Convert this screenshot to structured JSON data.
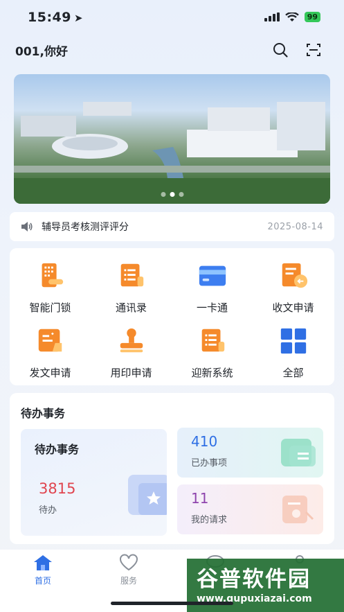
{
  "status_bar": {
    "time": "15:49",
    "battery": "99"
  },
  "header": {
    "greeting": "001,你好"
  },
  "banner": {
    "slide_count": 3,
    "active_slide": 2
  },
  "notice": {
    "title": "辅导员考核测评评分",
    "date": "2025-08-14"
  },
  "quick_apps": [
    {
      "label": "智能门锁",
      "icon": "smart-lock-icon"
    },
    {
      "label": "通讯录",
      "icon": "contacts-icon"
    },
    {
      "label": "一卡通",
      "icon": "card-icon"
    },
    {
      "label": "收文申请",
      "icon": "receive-doc-icon"
    },
    {
      "label": "发文申请",
      "icon": "send-doc-icon"
    },
    {
      "label": "用印申请",
      "icon": "seal-icon"
    },
    {
      "label": "迎新系统",
      "icon": "welcome-system-icon"
    },
    {
      "label": "全部",
      "icon": "all-apps-icon"
    }
  ],
  "todo": {
    "section_title": "待办事务",
    "pending": {
      "title": "待办事务",
      "count": "3815",
      "label": "待办"
    },
    "done": {
      "count": "410",
      "label": "已办事项"
    },
    "requests": {
      "count": "11",
      "label": "我的请求"
    }
  },
  "tabbar": {
    "items": [
      {
        "label": "首页"
      },
      {
        "label": "服务"
      }
    ]
  },
  "watermark": {
    "title": "谷普软件园",
    "url": "www.gupuxiazai.com"
  },
  "colors": {
    "accent": "#2f6fe4",
    "orange": "#f58a2b",
    "pending_red": "#e0454f",
    "done_blue": "#2f6fe4",
    "request_purple": "#8e44ad"
  }
}
